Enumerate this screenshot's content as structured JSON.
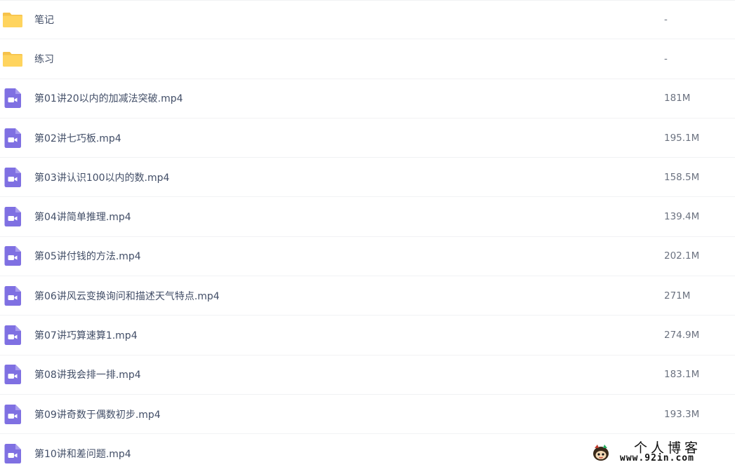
{
  "colors": {
    "folder": "#ffd45e",
    "folder_tab": "#f6c24a",
    "video": "#7f70e2",
    "name_text": "#424e67",
    "size_text": "#6b7280",
    "divider": "#f1f2f4"
  },
  "files": [
    {
      "icon": "folder-icon",
      "name": "笔记",
      "size": "-"
    },
    {
      "icon": "folder-icon",
      "name": "练习",
      "size": "-"
    },
    {
      "icon": "video-file-icon",
      "name": "第01讲20以内的加减法突破.mp4",
      "size": "181M"
    },
    {
      "icon": "video-file-icon",
      "name": "第02讲七巧板.mp4",
      "size": "195.1M"
    },
    {
      "icon": "video-file-icon",
      "name": "第03讲认识100以内的数.mp4",
      "size": "158.5M"
    },
    {
      "icon": "video-file-icon",
      "name": "第04讲简单推理.mp4",
      "size": "139.4M"
    },
    {
      "icon": "video-file-icon",
      "name": "第05讲付钱的方法.mp4",
      "size": "202.1M"
    },
    {
      "icon": "video-file-icon",
      "name": "第06讲风云变换询问和描述天气特点.mp4",
      "size": "271M"
    },
    {
      "icon": "video-file-icon",
      "name": "第07讲巧算速算1.mp4",
      "size": "274.9M"
    },
    {
      "icon": "video-file-icon",
      "name": "第08讲我会排一排.mp4",
      "size": "183.1M"
    },
    {
      "icon": "video-file-icon",
      "name": "第09讲奇数于偶数初步.mp4",
      "size": "193.3M"
    },
    {
      "icon": "video-file-icon",
      "name": "第10讲和差问题.mp4",
      "size": ""
    }
  ],
  "watermark": {
    "title": "个人博客",
    "url": "www.92in.com"
  }
}
